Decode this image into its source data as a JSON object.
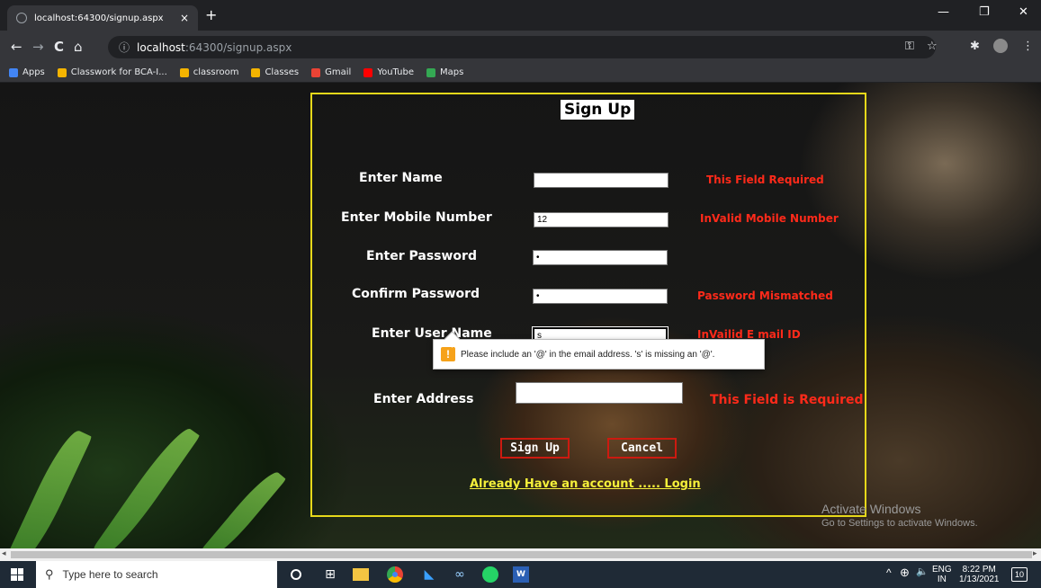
{
  "browser": {
    "tab_title": "localhost:64300/signup.aspx",
    "tab_close": "×",
    "new_tab": "+",
    "url_host": "localhost",
    "url_path": ":64300/signup.aspx",
    "info_icon": "ⓘ",
    "window_min": "—",
    "window_restore": "❐",
    "window_close": "✕",
    "back": "←",
    "forward": "→",
    "reload": "C",
    "home": "⌂",
    "key_icon": "⚿",
    "star_icon": "☆",
    "ext_icon": "✱",
    "menu_icon": "⋮"
  },
  "bookmarks": [
    {
      "label": "Apps",
      "color": "#4285f4"
    },
    {
      "label": "Classwork for BCA-I...",
      "color": "#f4b400"
    },
    {
      "label": "classroom",
      "color": "#f4b400"
    },
    {
      "label": "Classes",
      "color": "#f4b400"
    },
    {
      "label": "Gmail",
      "color": "#ea4335"
    },
    {
      "label": "YouTube",
      "color": "#ff0000"
    },
    {
      "label": "Maps",
      "color": "#34a853"
    }
  ],
  "form": {
    "title": "Sign Up",
    "name_label": "Enter Name",
    "name_value": "",
    "name_error": "This Field Required",
    "mobile_label": "Enter Mobile Number",
    "mobile_value": "12",
    "mobile_error": "InValid Mobile Number",
    "password_label": "Enter Password",
    "password_value": "•",
    "confirm_label": "Confirm Password",
    "confirm_value": "•",
    "confirm_error": "Password Mismatched",
    "username_label": "Enter User Name",
    "username_value": "s",
    "username_error": "InVailid E mail ID",
    "address_label": "Enter Address",
    "address_error": "This Field is Required",
    "signup_button": "Sign Up",
    "cancel_button": "Cancel",
    "login_link": "Already Have an account ..... Login"
  },
  "tooltip": {
    "icon": "!",
    "text": "Please include an '@' in the email address. 's' is missing an '@'."
  },
  "watermark": {
    "line1": "Activate Windows",
    "line2": "Go to Settings to activate Windows."
  },
  "taskbar": {
    "search_placeholder": "Type here to search",
    "search_icon": "⚲",
    "lang_top": "ENG",
    "lang_bottom": "IN",
    "time": "8:22 PM",
    "date": "1/13/2021",
    "notification_count": "10",
    "tray_arrow": "^",
    "network_icon": "⊕",
    "volume_icon": "🔈"
  }
}
